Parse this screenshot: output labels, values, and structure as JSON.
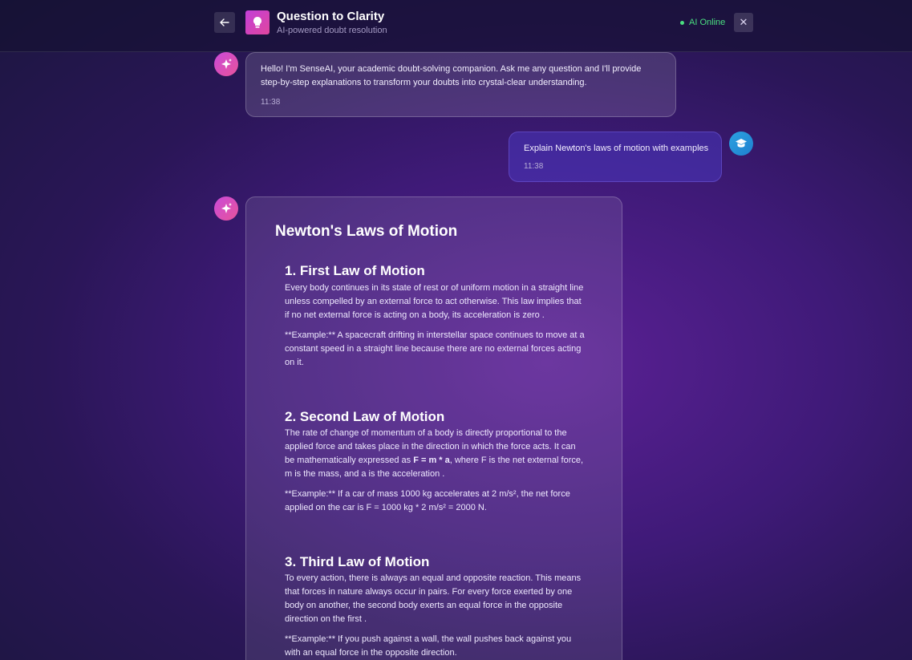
{
  "header": {
    "back_icon": "arrow-left-icon",
    "app_icon": "lightbulb-icon",
    "title": "Question to Clarity",
    "subtitle": "AI-powered doubt resolution",
    "status": "AI Online",
    "status_color": "#4ade80",
    "close_label": "✕"
  },
  "messages": {
    "welcome": {
      "avatar_icon": "sparkles-icon",
      "text": "Hello! I'm SenseAI, your academic doubt-solving companion. Ask me any question and I'll provide step-by-step explanations to transform your doubts into crystal-clear understanding.",
      "time": "11:38"
    },
    "user": {
      "avatar_icon": "graduation-cap-icon",
      "text": "Explain Newton's laws of motion with examples",
      "time": "11:38"
    },
    "response": {
      "avatar_icon": "sparkles-icon",
      "title": "Newton's Laws of Motion",
      "laws": [
        {
          "heading": "1. First Law of Motion",
          "body": "Every body continues in its state of rest or of uniform motion in a straight line unless compelled by an external force to act otherwise. This law implies that if no net external force is acting on a body, its acceleration is zero .",
          "example": "**Example:** A spacecraft drifting in interstellar space continues to move at a constant speed in a straight line because there are no external forces acting on it."
        },
        {
          "heading": "2. Second Law of Motion",
          "body_pre": "The rate of change of momentum of a body is directly proportional to the applied force and takes place in the direction in which the force acts. It can be mathematically expressed as ",
          "body_formula": "F = m * a",
          "body_post": ", where F is the net external force, m is the mass, and a is the acceleration .",
          "example": "**Example:** If a car of mass 1000 kg accelerates at 2 m/s², the net force applied on the car is F = 1000 kg * 2 m/s² = 2000 N."
        },
        {
          "heading": "3. Third Law of Motion",
          "body": "To every action, there is always an equal and opposite reaction. This means that forces in nature always occur in pairs. For every force exerted by one body on another, the second body exerts an equal force in the opposite direction on the first .",
          "example": "**Example:** If you push against a wall, the wall pushes back against you with an equal force in the opposite direction."
        }
      ]
    }
  }
}
